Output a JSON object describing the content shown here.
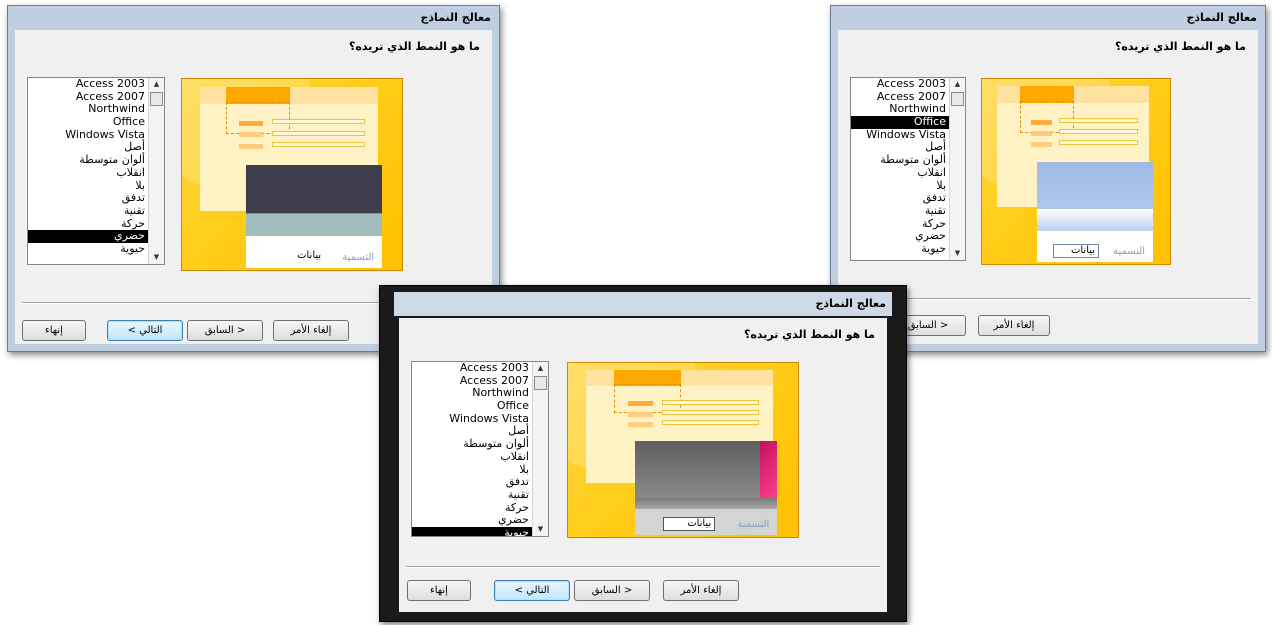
{
  "dialog": {
    "title": "معالج النماذج",
    "prompt": "ما هو النمط الذي تريده؟",
    "styles": [
      "Access 2003",
      "Access 2007",
      "Northwind",
      "Office",
      "Windows Vista",
      "أصل",
      "ألوان متوسطة",
      "انقلاب",
      "بلا",
      "تدفق",
      "تقنية",
      "حركة",
      "حضري",
      "حيوية"
    ],
    "preview_caption": "التسمية",
    "preview_value": "بيانات",
    "buttons": {
      "cancel": "إلغاء الأمر",
      "back": "< السابق",
      "next": "التالي >",
      "finish": "إنهاء"
    }
  },
  "windows": [
    {
      "selected_style": "حضري"
    },
    {
      "selected_style": "Office"
    },
    {
      "selected_style": "حيوية"
    }
  ],
  "colors": {
    "preview_background": "#ffc000",
    "urban_header": "#3d3d4e",
    "urban_band": "#a0bcbc",
    "office_header": "#a6bfe4",
    "vivid_header": "#6c6c6c",
    "vivid_accent": "#e8246c"
  }
}
